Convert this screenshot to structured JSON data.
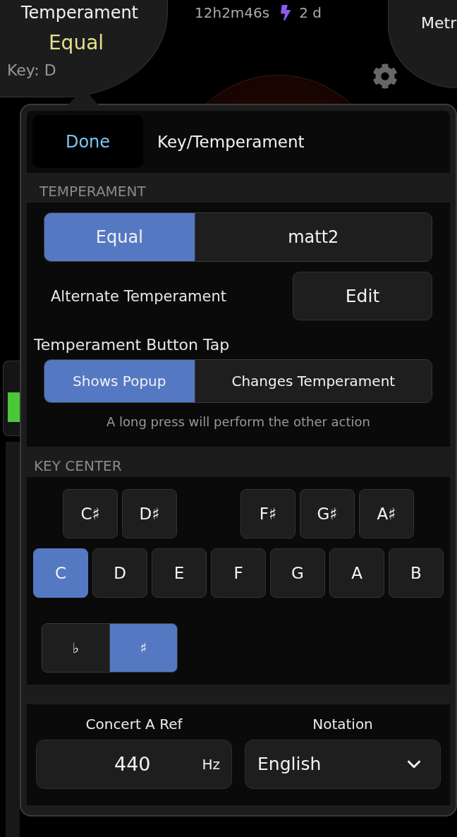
{
  "header": {
    "title": "Temperament",
    "value": "Equal",
    "key": "Key: D"
  },
  "status": {
    "elapsed": "12h2m46s",
    "battery": "2 d"
  },
  "right_button": {
    "label": "Metr"
  },
  "popup": {
    "done": "Done",
    "title": "Key/Temperament",
    "temperament": {
      "heading": "TEMPERAMENT",
      "options": [
        {
          "label": "Equal",
          "selected": true
        },
        {
          "label": "matt2",
          "selected": false
        }
      ],
      "alternate_label": "Alternate Temperament",
      "edit": "Edit",
      "tap_label": "Temperament Button Tap",
      "tap_options": [
        {
          "label": "Shows Popup",
          "selected": true
        },
        {
          "label": "Changes Temperament",
          "selected": false
        }
      ],
      "note": "A long press will perform the other action"
    },
    "key_center": {
      "heading": "KEY CENTER",
      "sharps": [
        {
          "label": "C♯",
          "selected": false
        },
        {
          "label": "D♯",
          "selected": false
        },
        {
          "label": "F♯",
          "selected": false
        },
        {
          "label": "G♯",
          "selected": false
        },
        {
          "label": "A♯",
          "selected": false
        }
      ],
      "naturals": [
        {
          "label": "C",
          "selected": true
        },
        {
          "label": "D",
          "selected": false
        },
        {
          "label": "E",
          "selected": false
        },
        {
          "label": "F",
          "selected": false
        },
        {
          "label": "G",
          "selected": false
        },
        {
          "label": "A",
          "selected": false
        },
        {
          "label": "B",
          "selected": false
        }
      ],
      "accidentals": [
        {
          "label": "♭",
          "selected": false
        },
        {
          "label": "♯",
          "selected": true
        }
      ]
    },
    "concert": {
      "label": "Concert A Ref",
      "value": "440",
      "unit": "Hz"
    },
    "notation": {
      "label": "Notation",
      "value": "English"
    }
  }
}
